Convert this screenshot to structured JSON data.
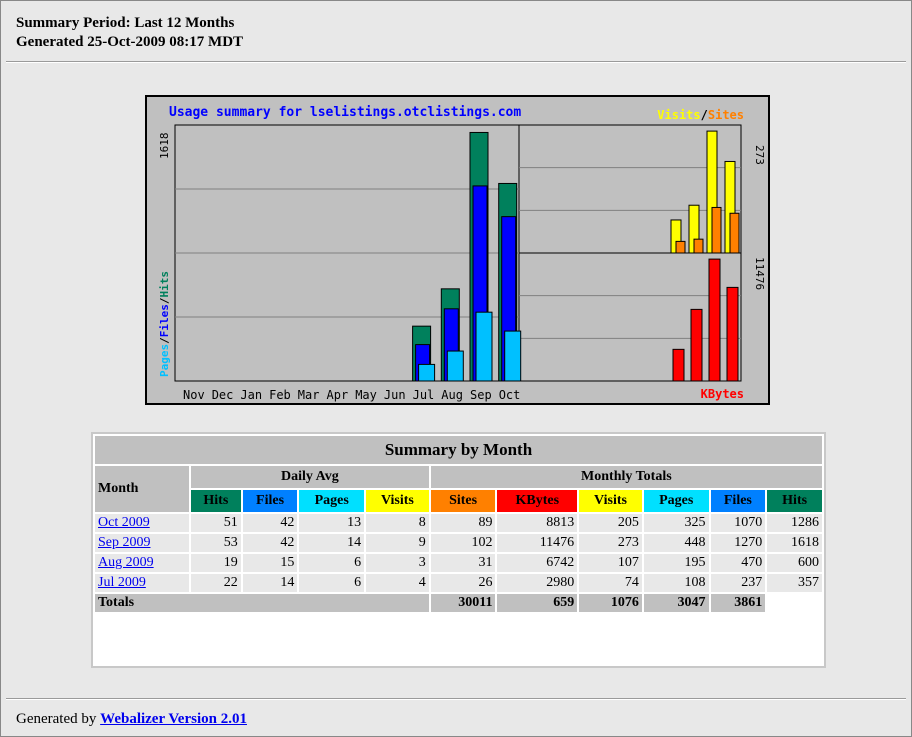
{
  "header": {
    "period": "Summary Period: Last 12 Months",
    "generated": "Generated 25-Oct-2009 08:17 MDT"
  },
  "chart_data": {
    "type": "bar",
    "title": "Usage summary for lselistings.otclistings.com",
    "categories": [
      "Nov",
      "Dec",
      "Jan",
      "Feb",
      "Mar",
      "Apr",
      "May",
      "Jun",
      "Jul",
      "Aug",
      "Sep",
      "Oct"
    ],
    "left_axis_label": {
      "pages": "Pages",
      "files": "Files",
      "hits": "Hits",
      "sep": "/"
    },
    "left_max": 1618,
    "top_right_max": 273,
    "bottom_right_max": 11476,
    "top_right_label": {
      "visits": "Visits",
      "sites": "Sites",
      "sep": "/"
    },
    "bottom_right_label": "KBytes",
    "series": {
      "hits": [
        0,
        0,
        0,
        0,
        0,
        0,
        0,
        0,
        357,
        600,
        1618,
        1286
      ],
      "files": [
        0,
        0,
        0,
        0,
        0,
        0,
        0,
        0,
        237,
        470,
        1270,
        1070
      ],
      "pages": [
        0,
        0,
        0,
        0,
        0,
        0,
        0,
        0,
        108,
        195,
        448,
        325
      ],
      "visits": [
        74,
        107,
        273,
        205
      ],
      "sites": [
        26,
        31,
        102,
        89
      ],
      "kbytes": [
        2980,
        6742,
        11476,
        8813
      ]
    },
    "colors": {
      "hits": "#00805c",
      "files": "#0000ff",
      "pages": "#00c0ff",
      "visits": "#ffff00",
      "sites": "#ff8000",
      "kbytes": "#ff0000"
    }
  },
  "summary": {
    "title": "Summary by Month",
    "month_header": "Month",
    "daily_avg": "Daily Avg",
    "monthly_totals": "Monthly Totals",
    "cols": [
      {
        "label": "Hits",
        "color": "#00805c",
        "fg": "#000"
      },
      {
        "label": "Files",
        "color": "#0080ff",
        "fg": "#000"
      },
      {
        "label": "Pages",
        "color": "#00e0ff",
        "fg": "#000"
      },
      {
        "label": "Visits",
        "color": "#ffff00",
        "fg": "#000"
      },
      {
        "label": "Sites",
        "color": "#ff8000",
        "fg": "#000"
      },
      {
        "label": "KBytes",
        "color": "#ff0000",
        "fg": "#000"
      },
      {
        "label": "Visits",
        "color": "#ffff00",
        "fg": "#000"
      },
      {
        "label": "Pages",
        "color": "#00e0ff",
        "fg": "#000"
      },
      {
        "label": "Files",
        "color": "#0080ff",
        "fg": "#000"
      },
      {
        "label": "Hits",
        "color": "#00805c",
        "fg": "#000"
      }
    ],
    "rows": [
      {
        "month": "Oct 2009",
        "values": [
          "51",
          "42",
          "13",
          "8",
          "89",
          "8813",
          "205",
          "325",
          "1070",
          "1286"
        ]
      },
      {
        "month": "Sep 2009",
        "values": [
          "53",
          "42",
          "14",
          "9",
          "102",
          "11476",
          "273",
          "448",
          "1270",
          "1618"
        ]
      },
      {
        "month": "Aug 2009",
        "values": [
          "19",
          "15",
          "6",
          "3",
          "31",
          "6742",
          "107",
          "195",
          "470",
          "600"
        ]
      },
      {
        "month": "Jul 2009",
        "values": [
          "22",
          "14",
          "6",
          "4",
          "26",
          "2980",
          "74",
          "108",
          "237",
          "357"
        ]
      }
    ],
    "totals_label": "Totals",
    "totals": [
      "30011",
      "659",
      "1076",
      "3047",
      "3861"
    ]
  },
  "footer": {
    "prefix": "Generated by ",
    "link": "Webalizer Version 2.01"
  }
}
